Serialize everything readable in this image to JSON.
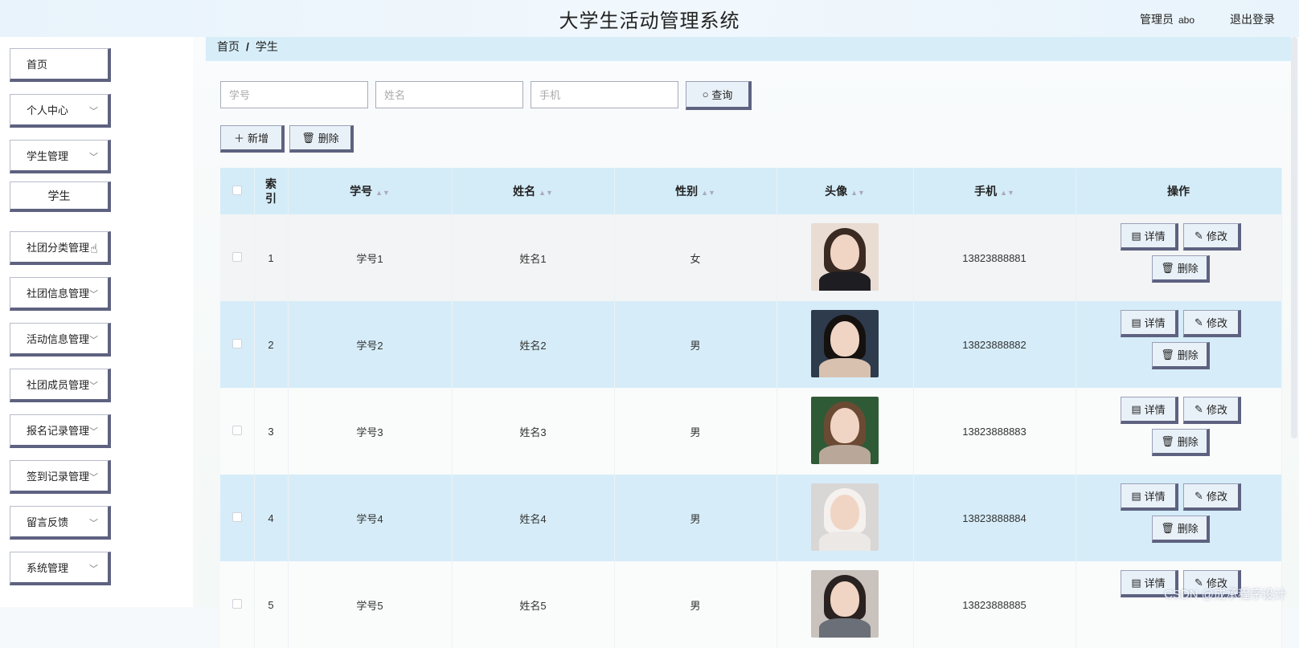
{
  "header": {
    "title": "大学生活动管理系统",
    "role": "管理员",
    "username": "abo",
    "logout": "退出登录"
  },
  "sidebar": {
    "items": [
      {
        "label": "首页",
        "icon": "none"
      },
      {
        "label": "个人中心",
        "icon": "chevron-down-icon"
      },
      {
        "label": "学生管理",
        "icon": "chevron-down-icon"
      },
      {
        "label": "社团分类管理",
        "icon": "none"
      },
      {
        "label": "社团信息管理",
        "icon": "chevron-down-icon"
      },
      {
        "label": "活动信息管理",
        "icon": "chevron-down-icon"
      },
      {
        "label": "社团成员管理",
        "icon": "chevron-down-icon"
      },
      {
        "label": "报名记录管理",
        "icon": "chevron-down-icon"
      },
      {
        "label": "签到记录管理",
        "icon": "chevron-down-icon"
      },
      {
        "label": "留言反馈",
        "icon": "chevron-down-icon"
      },
      {
        "label": "系统管理",
        "icon": "chevron-down-icon"
      }
    ],
    "sub_items": [
      {
        "label": "学生"
      }
    ]
  },
  "breadcrumb": {
    "home": "首页",
    "sep": "/",
    "current": "学生"
  },
  "search": {
    "student_no_placeholder": "学号",
    "name_placeholder": "姓名",
    "phone_placeholder": "手机",
    "query_label": "查询"
  },
  "toolbar": {
    "add_label": "新增",
    "delete_label": "删除"
  },
  "table": {
    "headers": {
      "index": "索引",
      "student_no": "学号",
      "name": "姓名",
      "gender": "性别",
      "avatar": "头像",
      "phone": "手机",
      "actions": "操作"
    },
    "rows": [
      {
        "index": "1",
        "student_no": "学号1",
        "name": "姓名1",
        "gender": "女",
        "phone": "13823888881"
      },
      {
        "index": "2",
        "student_no": "学号2",
        "name": "姓名2",
        "gender": "男",
        "phone": "13823888882"
      },
      {
        "index": "3",
        "student_no": "学号3",
        "name": "姓名3",
        "gender": "男",
        "phone": "13823888883"
      },
      {
        "index": "4",
        "student_no": "学号4",
        "name": "姓名4",
        "gender": "男",
        "phone": "13823888884"
      },
      {
        "index": "5",
        "student_no": "学号5",
        "name": "姓名5",
        "gender": "男",
        "phone": "13823888885"
      }
    ],
    "action_labels": {
      "detail": "详情",
      "edit": "修改",
      "delete": "删除"
    }
  },
  "watermark": "CSDN @成承程序设计",
  "colors": {
    "accent": "#d4ecf8",
    "button_shadow": "#5e6280",
    "row_alt": "#d6edf9"
  }
}
